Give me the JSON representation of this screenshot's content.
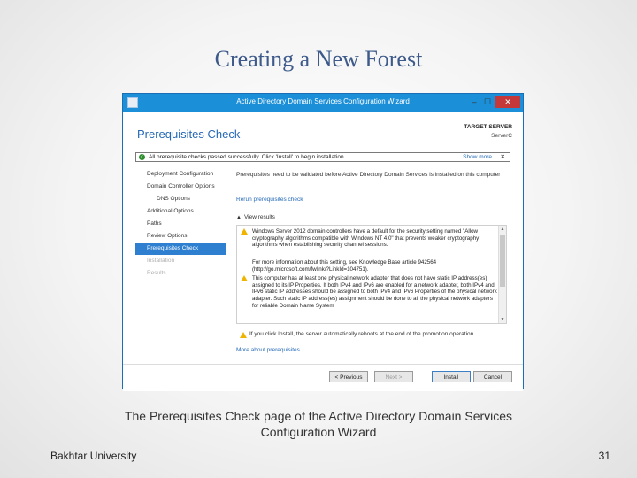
{
  "slide": {
    "title": "Creating a New Forest",
    "caption": "The Prerequisites Check page of the Active Directory Domain Services Configuration Wizard",
    "footer_left": "Bakhtar University",
    "page_number": "31"
  },
  "window": {
    "title": "Active Directory Domain Services Configuration Wizard",
    "controls": {
      "minimize": "–",
      "maximize": "☐",
      "close": "✕"
    },
    "header": "Prerequisites Check",
    "target_label": "TARGET SERVER",
    "target_name": "ServerC",
    "notice": {
      "text": "All prerequisite checks passed successfully. Click 'Install' to begin installation.",
      "more": "Show more",
      "close": "✕"
    },
    "nav": [
      {
        "label": "Deployment Configuration",
        "state": "normal",
        "sub": false
      },
      {
        "label": "Domain Controller Options",
        "state": "normal",
        "sub": false
      },
      {
        "label": "DNS Options",
        "state": "normal",
        "sub": true
      },
      {
        "label": "Additional Options",
        "state": "normal",
        "sub": false
      },
      {
        "label": "Paths",
        "state": "normal",
        "sub": false
      },
      {
        "label": "Review Options",
        "state": "normal",
        "sub": false
      },
      {
        "label": "Prerequisites Check",
        "state": "active",
        "sub": false
      },
      {
        "label": "Installation",
        "state": "dim",
        "sub": false
      },
      {
        "label": "Results",
        "state": "dim",
        "sub": false
      }
    ],
    "content": {
      "description": "Prerequisites need to be validated before Active Directory Domain Services is installed on this computer",
      "rerun_link": "Rerun prerequisites check",
      "view_results": "View results",
      "results": [
        "Windows Server 2012 domain controllers have a default for the security setting named \"Allow cryptography algorithms compatible with Windows NT 4.0\" that prevents weaker cryptography algorithms when establishing security channel sessions.",
        "For more information about this setting, see Knowledge Base article 942564 (http://go.microsoft.com/fwlink/?LinkId=104751).",
        "This computer has at least one physical network adapter that does not have static IP address(es) assigned to its IP Properties. If both IPv4 and IPv6 are enabled for a network adapter, both IPv4 and IPv6 static IP addresses should be assigned to both IPv4 and IPv6 Properties of the physical network adapter. Such static IP address(es) assignment should be done to all the physical network adapters for reliable Domain Name System"
      ],
      "bottom_warning": "If you click Install, the server automatically reboots at the end of the promotion operation.",
      "more_link": "More about prerequisites"
    },
    "buttons": {
      "previous": "< Previous",
      "next": "Next >",
      "install": "Install",
      "cancel": "Cancel"
    }
  },
  "colors": {
    "accent": "#1b8fd8",
    "header_text": "#2569b6",
    "selected_nav": "#2e7fd0",
    "warning": "#f0b400",
    "success": "#2f8f2f",
    "slide_title": "#3d5a8a"
  }
}
